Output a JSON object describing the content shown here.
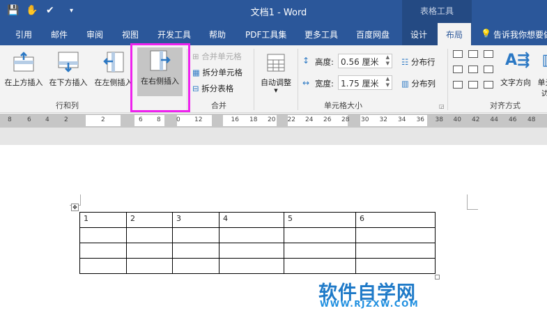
{
  "title": "文档1  -  Word",
  "context_tab": "表格工具",
  "qat": {
    "save": "save-icon",
    "touch": "touch-mode-icon",
    "customize": "▾"
  },
  "tabs": [
    "引用",
    "邮件",
    "审阅",
    "视图",
    "开发工具",
    "帮助",
    "PDF工具集",
    "更多工具",
    "百度网盘",
    "设计",
    "布局"
  ],
  "tell_me": "告诉我你想要做",
  "ribbon": {
    "rows_cols": {
      "label": "行和列",
      "buttons": [
        "在上方插入",
        "在下方插入",
        "在左侧插入",
        "在右侧插入"
      ]
    },
    "merge": {
      "label": "合并",
      "buttons": [
        "合并单元格",
        "拆分单元格",
        "拆分表格"
      ]
    },
    "cell_size": {
      "label": "单元格大小",
      "autofit": "自动调整",
      "height_label": "高度:",
      "height_value": "0.56 厘米",
      "width_label": "宽度:",
      "width_value": "1.75 厘米",
      "dist_rows": "分布行",
      "dist_cols": "分布列"
    },
    "align": {
      "label": "对齐方式",
      "text_dir": "文字方向",
      "cell_margin": "单元格边距"
    }
  },
  "ruler": [
    "8",
    "6",
    "4",
    "2",
    "2",
    "6",
    "8",
    "0",
    "12",
    "16",
    "18",
    "20",
    "22",
    "24",
    "26",
    "28",
    "30",
    "32",
    "34",
    "36",
    "38",
    "40",
    "42",
    "44",
    "46",
    "48"
  ],
  "table": [
    [
      "1",
      "2",
      "3",
      "4",
      "5",
      "6"
    ],
    [
      "",
      "",
      "",
      "",
      "",
      ""
    ],
    [
      "",
      "",
      "",
      "",
      "",
      ""
    ],
    [
      "",
      "",
      "",
      "",
      "",
      ""
    ]
  ],
  "watermark": {
    "title": "软件自学网",
    "url": "WWW.RJZXW.COM"
  },
  "colors": {
    "brand": "#2b579a",
    "highlight": "#ee22ee"
  }
}
